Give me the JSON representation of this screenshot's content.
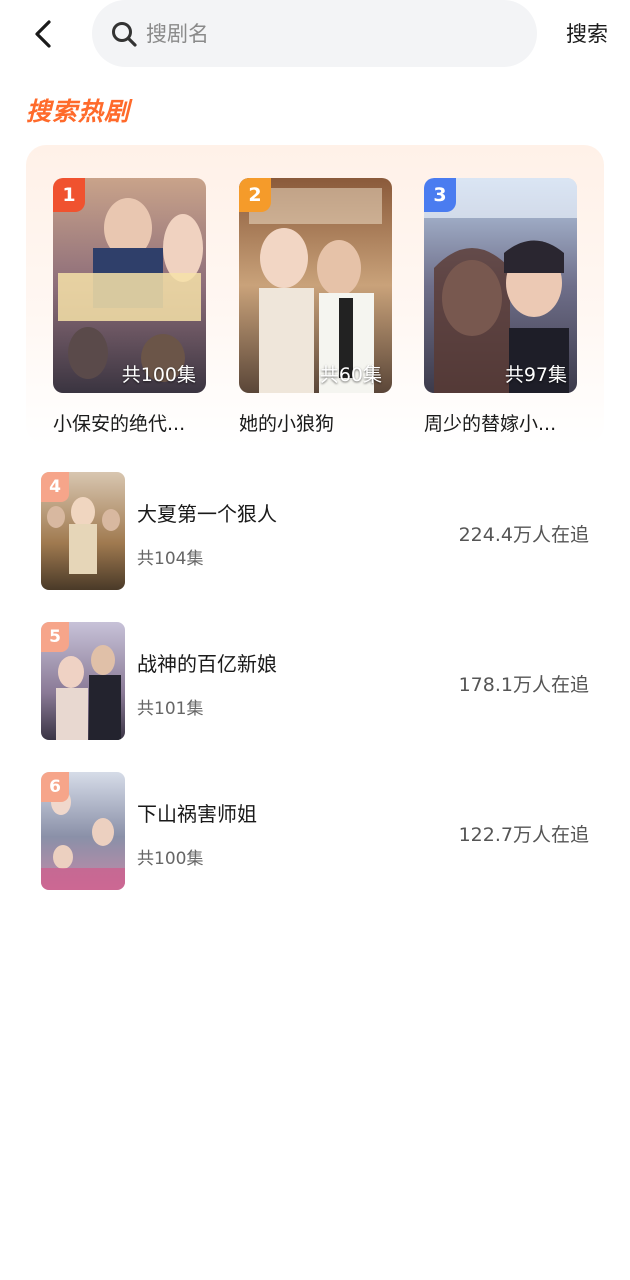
{
  "search": {
    "placeholder": "搜剧名",
    "action_label": "搜索"
  },
  "section": {
    "title": "搜索热剧",
    "accent_color": "#ff6a2b"
  },
  "top_dramas": [
    {
      "rank": "1",
      "episodes": "共100集",
      "title": "小保安的绝代...",
      "badge_color": "#f0522f"
    },
    {
      "rank": "2",
      "episodes": "共60集",
      "title": "她的小狼狗",
      "badge_color": "#f59b2a"
    },
    {
      "rank": "3",
      "episodes": "共97集",
      "title": "周少的替嫁小...",
      "badge_color": "#4a7cf0"
    }
  ],
  "list_dramas": [
    {
      "rank": "4",
      "title": "大夏第一个狠人",
      "episodes": "共104集",
      "followers": "224.4万人在追",
      "badge_color": "#f6a58a"
    },
    {
      "rank": "5",
      "title": "战神的百亿新娘",
      "episodes": "共101集",
      "followers": "178.1万人在追",
      "badge_color": "#f6a58a"
    },
    {
      "rank": "6",
      "title": "下山祸害师姐",
      "episodes": "共100集",
      "followers": "122.7万人在追",
      "badge_color": "#f6a58a"
    }
  ],
  "icons": {
    "back": "chevron-left-icon",
    "search": "search-icon"
  }
}
